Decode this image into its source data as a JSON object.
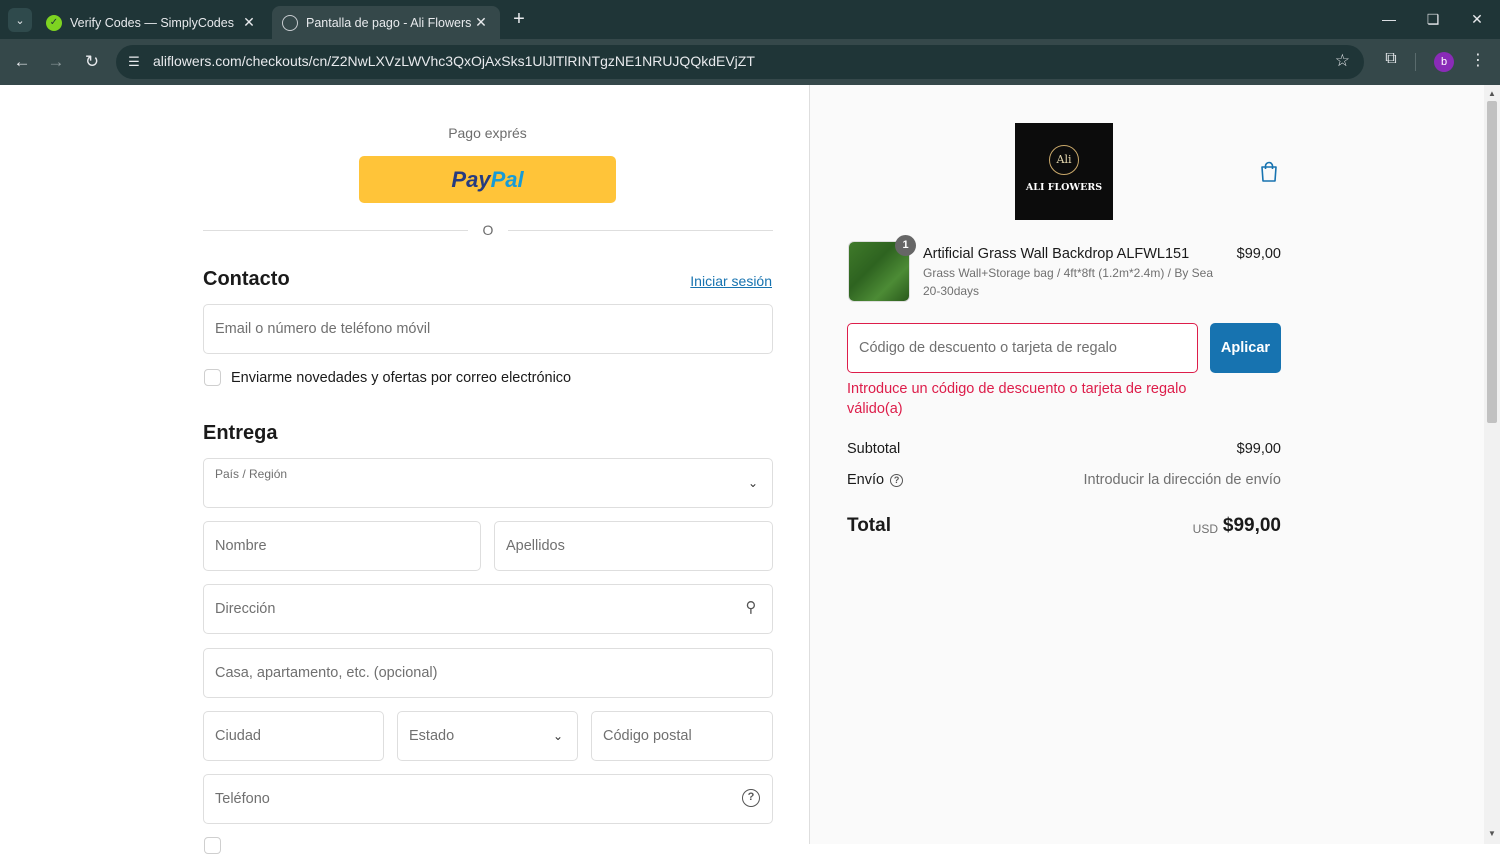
{
  "browser": {
    "tabs": [
      {
        "title": "Verify Codes — SimplyCodes",
        "active": false,
        "favicon": "simplycodes-icon"
      },
      {
        "title": "Pantalla de pago - Ali Flowers",
        "active": true,
        "favicon": "globe-icon"
      }
    ],
    "url": "aliflowers.com/checkouts/cn/Z2NwLXVzLWVhc3QxOjAxSks1UlJlTlRINTgzNE1NRUJQQkdEVjZT",
    "profile_initial": "b"
  },
  "checkout": {
    "express_label": "Pago exprés",
    "paypal": {
      "part1": "Pay",
      "part2": "Pal"
    },
    "or_label": "O",
    "contact": {
      "title": "Contacto",
      "login_link": "Iniciar sesión",
      "email_placeholder": "Email o número de teléfono móvil",
      "newsletter_label": "Enviarme novedades y ofertas por correo electrónico"
    },
    "delivery": {
      "title": "Entrega",
      "country_label": "País / Región",
      "first_name": "Nombre",
      "last_name": "Apellidos",
      "address": "Dirección",
      "apartment": "Casa, apartamento, etc. (opcional)",
      "city": "Ciudad",
      "state": "Estado",
      "postal": "Código postal",
      "phone": "Teléfono"
    }
  },
  "summary": {
    "logo_text": "ALI FLOWERS",
    "logo_crest": "Ali",
    "product": {
      "quantity": "1",
      "name": "Artificial Grass Wall Backdrop ALFWL151",
      "variant": "Grass Wall+Storage bag / 4ft*8ft (1.2m*2.4m) / By Sea 20-30days",
      "price": "$99,00"
    },
    "discount_placeholder": "Código de descuento o tarjeta de regalo",
    "apply_label": "Aplicar",
    "error": "Introduce un código de descuento o tarjeta de regalo válido(a)",
    "subtotal_label": "Subtotal",
    "subtotal_value": "$99,00",
    "shipping_label": "Envío",
    "shipping_value": "Introducir la dirección de envío",
    "total_label": "Total",
    "total_currency": "USD",
    "total_value": "$99,00"
  },
  "colors": {
    "accent": "#1773b0",
    "error": "#dd1d4a",
    "paypal": "#ffc439"
  }
}
